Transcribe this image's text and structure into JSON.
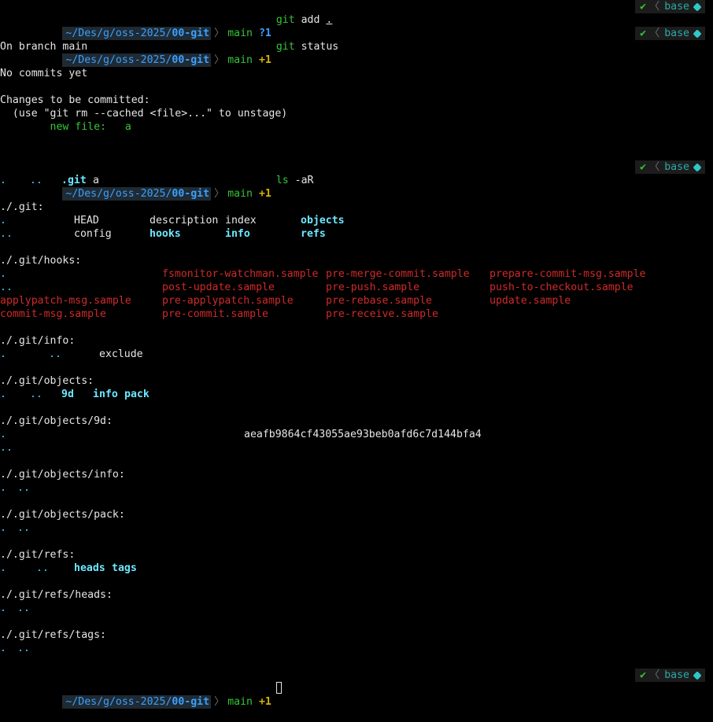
{
  "prompt": {
    "path_prefix": "~/Des/g/oss-2025/",
    "path_dir": "00-git",
    "branch": "main",
    "separator": "〉",
    "right": {
      "status_icon": "✔",
      "sep": "〈",
      "env": "base"
    }
  },
  "commands": [
    {
      "state": "?1",
      "verb": "git",
      "arg": "add",
      "arg2": "."
    },
    {
      "state": "+1",
      "verb": "git",
      "arg": "status"
    },
    {
      "state": "+1",
      "verb": "ls",
      "arg": "-aR"
    },
    {
      "state": "+1"
    }
  ],
  "status_output": {
    "l1": "On branch main",
    "l2": "No commits yet",
    "l3": "Changes to be committed:",
    "l4": "  (use \"git rm --cached <file>...\" to unstage)",
    "l5_label": "new file:",
    "l5_file": "a"
  },
  "ls": {
    "root": {
      "dot": ".",
      "dotdot": "..",
      "git": ".git",
      "file": "a"
    },
    "git_header": "./.git:",
    "git_row1": [
      ".",
      "HEAD",
      "description",
      "index",
      "objects"
    ],
    "git_row2": [
      "..",
      "config",
      "hooks",
      "info",
      "refs"
    ],
    "hooks_header": "./.git/hooks:",
    "hooks": [
      [
        ".",
        "fsmonitor-watchman.sample",
        "pre-merge-commit.sample",
        "prepare-commit-msg.sample"
      ],
      [
        "..",
        "post-update.sample",
        "pre-push.sample",
        "push-to-checkout.sample"
      ],
      [
        "applypatch-msg.sample",
        "pre-applypatch.sample",
        "pre-rebase.sample",
        "update.sample"
      ],
      [
        "commit-msg.sample",
        "pre-commit.sample",
        "pre-receive.sample",
        ""
      ]
    ],
    "info_header": "./.git/info:",
    "info_row": [
      ".",
      "..",
      "exclude"
    ],
    "objects_header": "./.git/objects:",
    "objects_row": [
      ".",
      "..",
      "9d",
      "info",
      "pack"
    ],
    "obj9d_header": "./.git/objects/9d:",
    "obj9d_row1": [
      ".",
      "aeafb9864cf43055ae93beb0afd6c7d144bfa4"
    ],
    "obj9d_row2": [
      ".."
    ],
    "objinfo_header": "./.git/objects/info:",
    "objinfo_row": [
      ".",
      ".."
    ],
    "objpack_header": "./.git/objects/pack:",
    "objpack_row": [
      ".",
      ".."
    ],
    "refs_header": "./.git/refs:",
    "refs_row": [
      ".",
      "..",
      "heads",
      "tags"
    ],
    "heads_header": "./.git/refs/heads:",
    "heads_row": [
      ".",
      ".."
    ],
    "tags_header": "./.git/refs/tags:",
    "tags_row": [
      ".",
      ".."
    ]
  }
}
